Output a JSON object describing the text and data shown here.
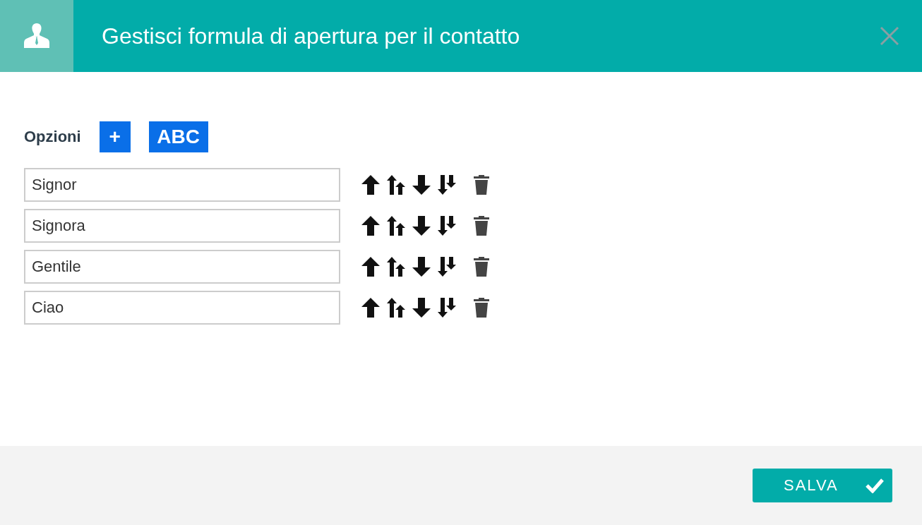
{
  "dialog": {
    "title": "Gestisci formula di apertura per il contatto"
  },
  "options": {
    "label": "Opzioni",
    "add_button": "+",
    "abc_button": "ABC"
  },
  "rows": [
    {
      "value": "Signor"
    },
    {
      "value": "Signora"
    },
    {
      "value": "Gentile"
    },
    {
      "value": "Ciao"
    }
  ],
  "footer": {
    "save_button": "SALVA"
  }
}
